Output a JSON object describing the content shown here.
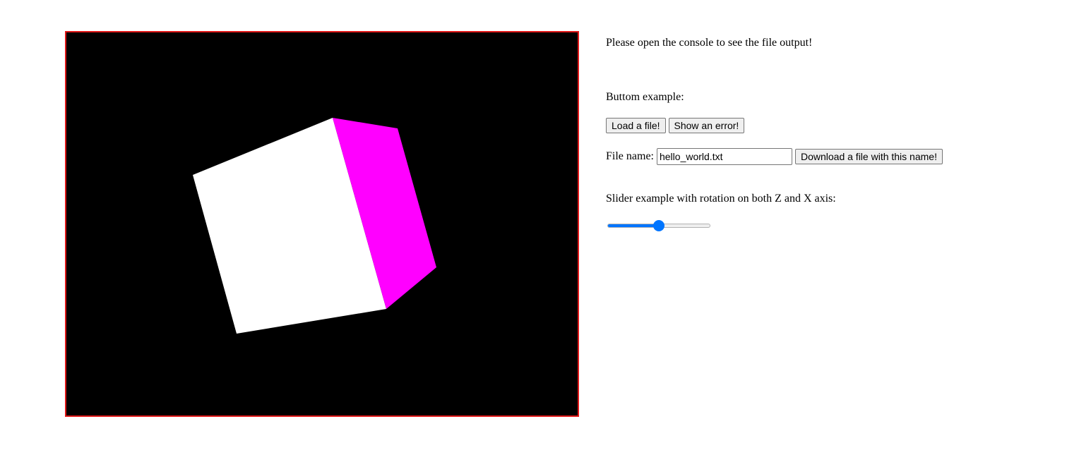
{
  "scene": {
    "background_color": "#000000",
    "border_color": "#e01818",
    "cube_front_color": "#ffffff",
    "cube_side_color": "#ff00ff"
  },
  "panel": {
    "console_note": "Please open the console to see the file output!",
    "button_heading": "Buttom example:",
    "load_button": "Load a file!",
    "error_button": "Show an error!",
    "file_name_label": "File name:",
    "file_name_value": "hello_world.txt",
    "download_button": "Download a file with this name!",
    "slider_heading": "Slider example with rotation on both Z and X axis:",
    "slider_value": 0.5,
    "accent_color": "#0075ff"
  }
}
